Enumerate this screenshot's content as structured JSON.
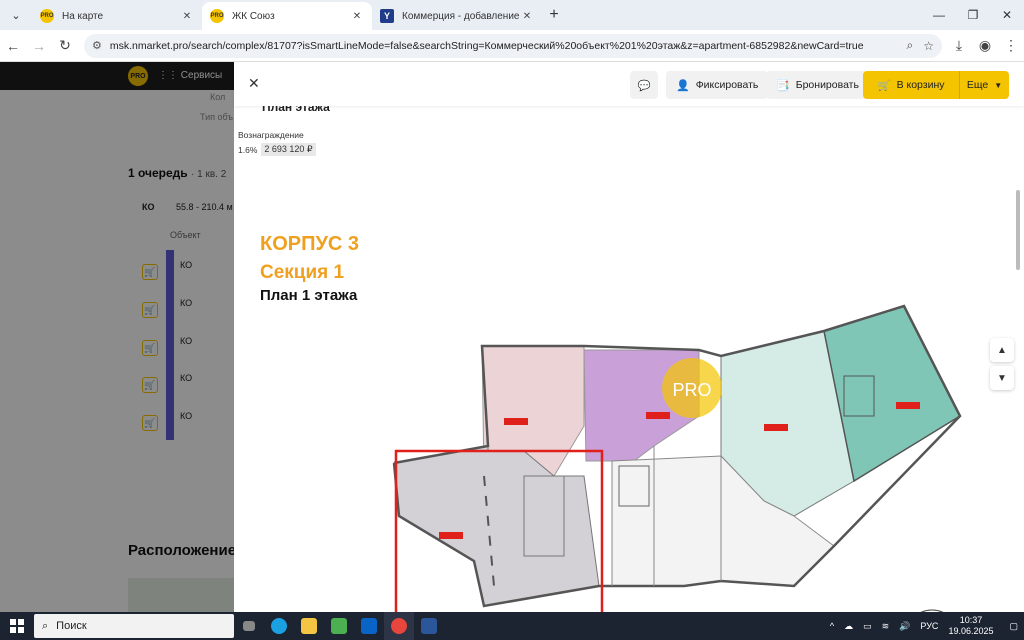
{
  "browser": {
    "tabs": [
      {
        "title": "На карте",
        "fav": "PRO",
        "active": false
      },
      {
        "title": "ЖК Союз",
        "fav": "PRO",
        "active": true
      },
      {
        "title": "Коммерция - добавление - С",
        "fav": "Y",
        "active": false
      }
    ],
    "url": "msk.nmarket.pro/search/complex/81707?isSmartLineMode=false&searchString=Коммерческий%20объект%201%20этаж&z=apartment-6852982&newCard=true"
  },
  "site": {
    "logo": "PRO",
    "services_label": "Сервисы",
    "queue_title": "1 очередь",
    "queue_sub": "· 1 кв. 2",
    "filter_label": "КО",
    "area_range": "55.8 - 210.4 м",
    "object_header": "Объект",
    "rows": [
      "КО",
      "КО",
      "КО",
      "КО",
      "КО"
    ],
    "muted1": "Кол",
    "muted2": "Тип объ",
    "location_title": "Расположение"
  },
  "modal": {
    "close_icon": "close-icon",
    "buttons": {
      "chat": "",
      "fix": "Фиксировать",
      "book": "Бронировать",
      "cart": "В корзину",
      "more": "Еще"
    },
    "plan_caption": "План этажа",
    "reward": {
      "label": "Вознаграждение",
      "percent": "1.6%",
      "amount": "2 693 120 ₽"
    },
    "plan": {
      "building": "КОРПУС 3",
      "section": "Секция 1",
      "floor": "План 1 этажа",
      "watermark": "PRO"
    }
  },
  "taskbar": {
    "search": "Поиск",
    "lang": "РУС",
    "time": "10:37",
    "date": "19.06.2025"
  },
  "colors": {
    "accent": "#f5c400",
    "highlight": "#e0201b"
  }
}
